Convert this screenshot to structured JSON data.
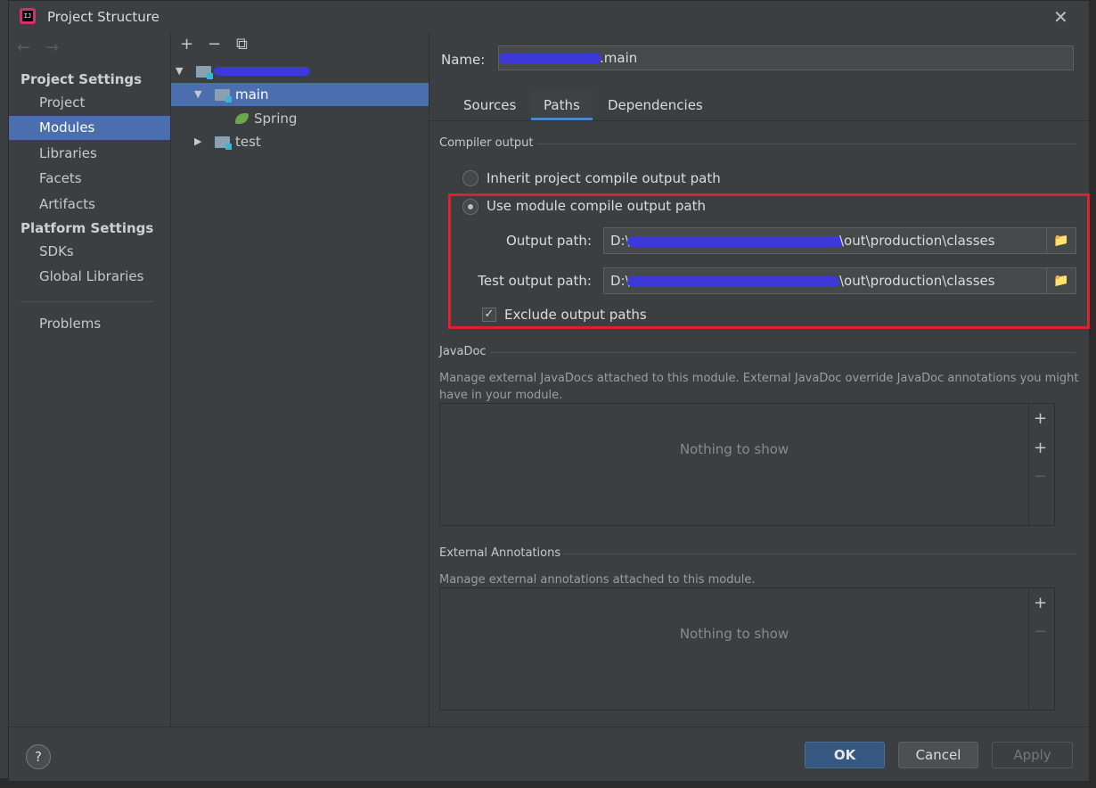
{
  "window": {
    "title": "Project Structure",
    "close_glyph": "✕",
    "logo_text": "IJ"
  },
  "nav": {
    "back_glyph": "←",
    "forward_glyph": "→",
    "section_project": "Project Settings",
    "project_items": [
      "Project",
      "Modules",
      "Libraries",
      "Facets",
      "Artifacts"
    ],
    "section_platform": "Platform Settings",
    "platform_items": [
      "SDKs",
      "Global Libraries"
    ],
    "problems": "Problems",
    "selected": "Modules"
  },
  "tree": {
    "toolbar": {
      "add": "+",
      "remove": "−",
      "copy": "⧉"
    },
    "nodes": [
      {
        "label": "",
        "expanded": true,
        "level": 0,
        "redacted": true
      },
      {
        "label": "main",
        "expanded": true,
        "level": 1,
        "selected": true
      },
      {
        "label": "Spring",
        "level": 2,
        "leaf": true
      },
      {
        "label": "test",
        "expanded": false,
        "level": 1
      }
    ]
  },
  "module": {
    "name_label": "Name:",
    "name_value": ".main",
    "tabs": [
      "Sources",
      "Paths",
      "Dependencies"
    ],
    "active_tab": "Paths"
  },
  "compiler_output": {
    "title": "Compiler output",
    "inherit_label": "Inherit project compile output path",
    "use_module_label": "Use module compile output path",
    "selected": "use_module",
    "output_path_label": "Output path:",
    "output_path_prefix": "D:\\",
    "output_path_suffix": "\\out\\production\\classes",
    "test_output_path_label": "Test output path:",
    "test_output_path_prefix": "D:\\",
    "test_output_path_suffix": "\\out\\production\\classes",
    "exclude_label": "Exclude output paths",
    "exclude_checked": true,
    "highlight_color": "#e0202a"
  },
  "javadoc": {
    "title": "JavaDoc",
    "description": "Manage external JavaDocs attached to this module. External JavaDoc override JavaDoc annotations you might have in your module.",
    "empty": "Nothing to show"
  },
  "annotations": {
    "title": "External Annotations",
    "description": "Manage external annotations attached to this module.",
    "empty": "Nothing to show"
  },
  "buttons": {
    "help": "?",
    "ok": "OK",
    "cancel": "Cancel",
    "apply": "Apply"
  },
  "colors": {
    "accent": "#4b6eaf",
    "redaction": "#3d39d8"
  }
}
